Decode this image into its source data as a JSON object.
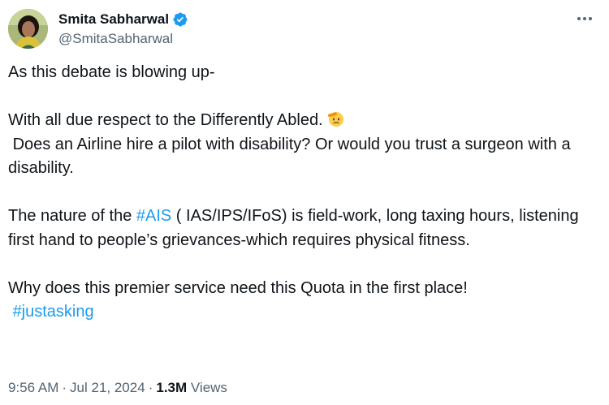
{
  "author": {
    "display_name": "Smita Sabharwal",
    "handle": "@SmitaSabharwal",
    "verified": true,
    "verified_color": "#1d9bf0"
  },
  "tweet": {
    "line1": "As this debate is blowing up-",
    "line2_text": "With all due respect to the Differently Abled.",
    "line2_emoji": "saluting-face-emoji",
    "line3": " Does an Airline hire a pilot with disability? Or would you trust a surgeon with a disability.",
    "para3_prefix": "The nature of the ",
    "hashtag_ais": "#AIS",
    "para3_suffix": " ( IAS/IPS/IFoS) is field-work, long taxing hours, listening first hand to people’s grievances-which requires physical fitness.",
    "para4": "Why does this premier service need this Quota in the first place!",
    "hashtag_justasking": "#justasking"
  },
  "meta": {
    "time": "9:56 AM",
    "date": "Jul 21, 2024",
    "views_count": "1.3M",
    "views_label": "Views",
    "separator": "·"
  },
  "colors": {
    "text": "#0f1419",
    "secondary": "#536471",
    "link": "#1d9bf0"
  }
}
